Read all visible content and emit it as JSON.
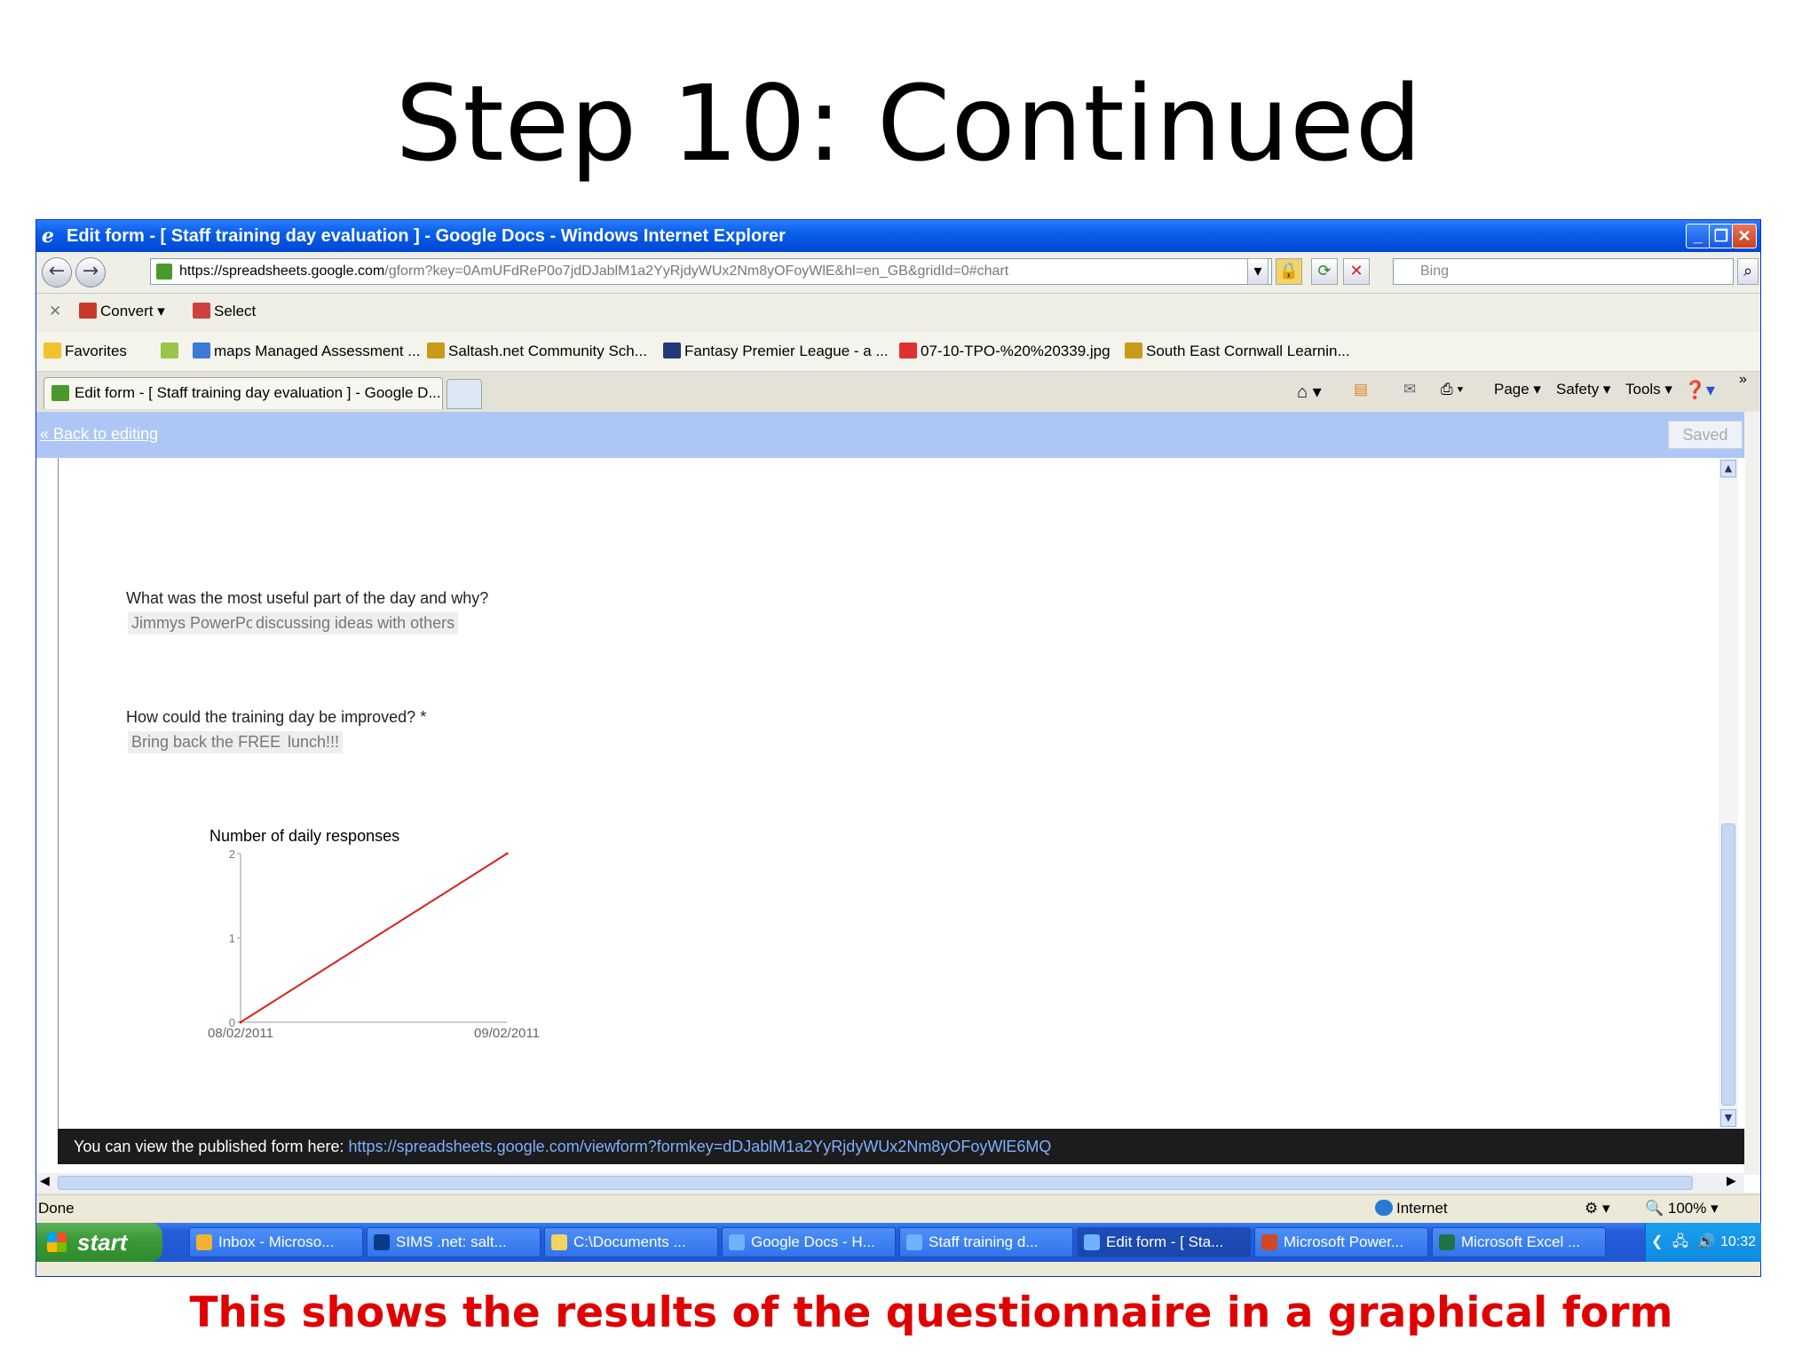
{
  "slide": {
    "title": "Step 10: Continued",
    "caption": "This shows the results of the questionnaire in a graphical form"
  },
  "window": {
    "title": "Edit form - [ Staff training day evaluation ] - Google Docs - Windows Internet Explorer"
  },
  "address": {
    "url_prefix": "https://",
    "url_host": "spreadsheets.google.com",
    "url_rest": "/gform?key=0AmUFdReP0o7jdDJablM1a2YyRjdyWUx2Nm8yOFoyWlE&hl=en_GB&gridId=0#chart",
    "search_placeholder": "Bing"
  },
  "commandbar": {
    "convert": "Convert",
    "select": "Select"
  },
  "favorites": {
    "label": "Favorites",
    "items": [
      "maps Managed Assessment ...",
      "Saltash.net Community Sch...",
      "Fantasy Premier League - a ...",
      "07-10-TPO-%20%20339.jpg",
      "South East Cornwall Learnin..."
    ]
  },
  "tabs": {
    "active": "Edit form - [ Staff training day evaluation ] - Google D..."
  },
  "ie_tools": {
    "page": "Page",
    "safety": "Safety",
    "tools": "Tools"
  },
  "gdocs": {
    "back_link": "« Back to editing",
    "saved": "Saved"
  },
  "questions": [
    {
      "text": "What was the most useful part of the day and why?",
      "answers": [
        "Jimmys PowerPoint",
        "discussing ideas with others"
      ]
    },
    {
      "text": "How could the training day be improved? *",
      "answers": [
        "Bring back the FREE food",
        "lunch!!!"
      ]
    }
  ],
  "chart_data": {
    "type": "line",
    "title": "Number of daily responses",
    "x": [
      "08/02/2011",
      "09/02/2011"
    ],
    "series": [
      {
        "values": [
          0,
          2
        ],
        "color": "#d62020"
      }
    ],
    "yticks": [
      "0",
      "1",
      "2"
    ],
    "ylim": [
      0,
      2
    ],
    "grid": false,
    "xlabel": "",
    "ylabel": ""
  },
  "publish": {
    "label": "You can view the published form here:",
    "url": "https://spreadsheets.google.com/viewform?formkey=dDJablM1a2YyRjdyWUx2Nm8yOFoyWlE6MQ"
  },
  "status": {
    "text": "Done",
    "zone": "Internet",
    "zoom": "100%"
  },
  "taskbar": {
    "start": "start",
    "items": [
      "Inbox - Microso...",
      "SIMS .net: salt...",
      "C:\\Documents ...",
      "Google Docs - H...",
      "Staff training d...",
      "Edit form - [ Sta...",
      "Microsoft Power...",
      "Microsoft Excel ..."
    ],
    "clock": "10:32"
  },
  "colors": {
    "accent_red": "#e00000",
    "gdocs_bar": "#adc6f5",
    "xp_blue": "#0046d5"
  }
}
